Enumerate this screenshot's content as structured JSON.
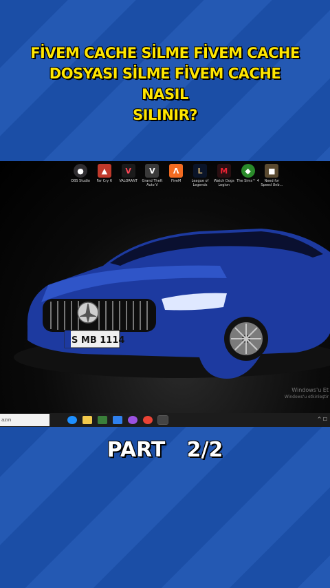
{
  "title": {
    "line1": "FİVEM CACHE SİLME FİVEM CACHE",
    "line2": "DOSYASI SİLME FİVEM CACHE NASIL",
    "line3": "SILINIR?"
  },
  "desktop": {
    "icons": [
      {
        "label": "OBS Studio",
        "icon": "obs-icon",
        "color": "#302e31"
      },
      {
        "label": "Far Cry 6",
        "icon": "farcry-icon",
        "color": "#c0392b"
      },
      {
        "label": "VALORANT",
        "icon": "valorant-icon",
        "color": "#1b1b1b"
      },
      {
        "label": "Grand Theft Auto V",
        "icon": "gta-icon",
        "color": "#3a3a3a"
      },
      {
        "label": "FiveM",
        "icon": "fivem-icon",
        "color": "#f26b21"
      },
      {
        "label": "League of Legends",
        "icon": "lol-icon",
        "color": "#0a1428"
      },
      {
        "label": "Watch Dogs Legion",
        "icon": "watchdogs-icon",
        "color": "#2a0f12"
      },
      {
        "label": "The Sims™ 4",
        "icon": "sims-icon",
        "color": "#2a8a2a"
      },
      {
        "label": "Need for Speed Unb...",
        "icon": "nfs-icon",
        "color": "#5a4a30"
      }
    ],
    "license_plate": "S MB 1114",
    "watermark_line1": "Windows'u Et",
    "watermark_line2": "Windows'u etkinleştir",
    "car_color": "#1f3fa8"
  },
  "taskbar": {
    "search_text": "azın",
    "tray_text": "^ ☐"
  },
  "part_label": "PART   2/2"
}
